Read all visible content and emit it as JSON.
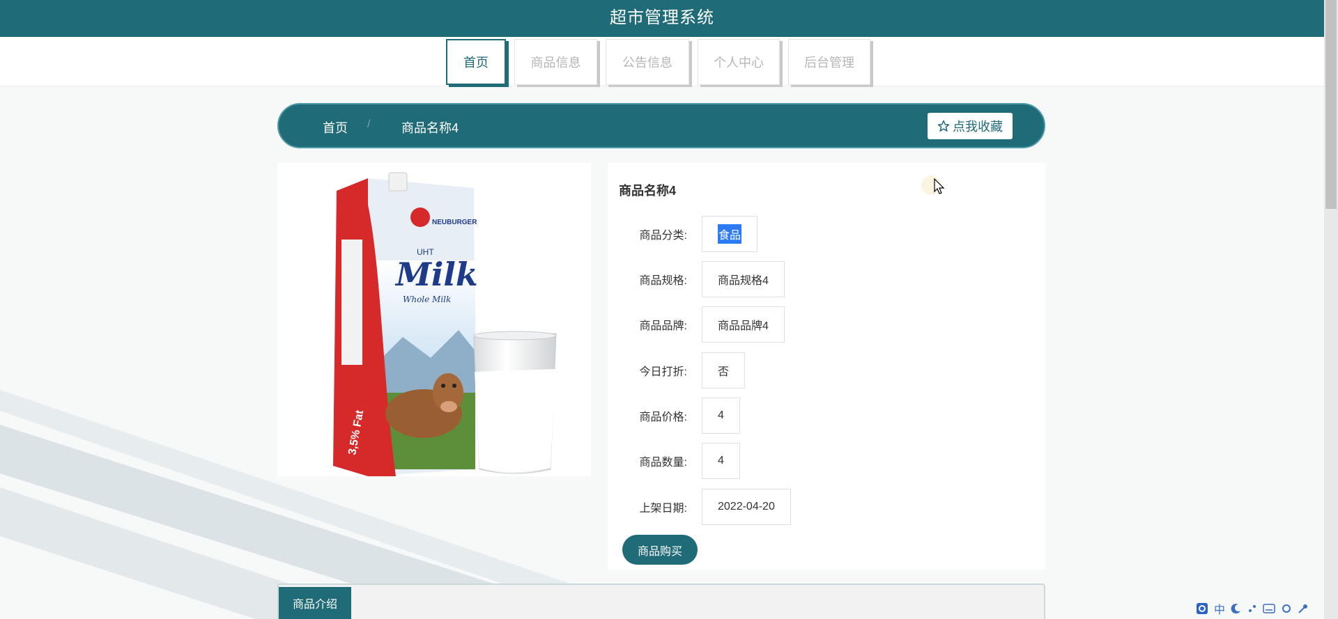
{
  "app": {
    "title": "超市管理系统"
  },
  "nav": {
    "items": [
      {
        "label": "首页"
      },
      {
        "label": "商品信息"
      },
      {
        "label": "公告信息"
      },
      {
        "label": "个人中心"
      },
      {
        "label": "后台管理"
      }
    ],
    "active": "首页"
  },
  "breadcrumb": {
    "home": "首页",
    "separator": "/",
    "current": "商品名称4"
  },
  "favorite": {
    "label": "点我收藏",
    "icon": "star-outline-icon"
  },
  "product": {
    "name": "商品名称4",
    "image_alt": "Milk",
    "fields": [
      {
        "label": "商品分类:",
        "value": "食品",
        "selected": true
      },
      {
        "label": "商品规格:",
        "value": "商品规格4"
      },
      {
        "label": "商品品牌:",
        "value": "商品品牌4"
      },
      {
        "label": "今日打折:",
        "value": "否"
      },
      {
        "label": "商品价格:",
        "value": "4"
      },
      {
        "label": "商品数量:",
        "value": "4"
      },
      {
        "label": "上架日期:",
        "value": "2022-04-20"
      }
    ],
    "buy_label": "商品购买"
  },
  "tabs": {
    "intro": "商品介绍"
  },
  "image_text": {
    "brand": "NEUBURGER",
    "uht": "UHT",
    "milk": "Milk",
    "sub": "Whole Milk",
    "fat": "3,5% Fat"
  },
  "colors": {
    "primary": "#206b78",
    "selection": "#2d7bf4"
  },
  "tray": {
    "ime": "中"
  }
}
